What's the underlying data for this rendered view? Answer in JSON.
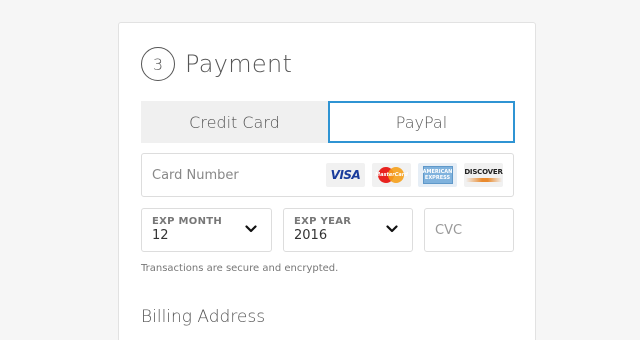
{
  "section": {
    "step_number": "3",
    "title": "Payment"
  },
  "tabs": [
    {
      "label": "Credit Card",
      "selected": false
    },
    {
      "label": "PayPal",
      "selected": true
    }
  ],
  "card_number": {
    "placeholder": "Card Number",
    "value": ""
  },
  "card_logos": {
    "visa": "VISA",
    "mastercard": "MasterCard",
    "amex": "AMERICAN EXPRESS",
    "discover": "DISCOVER"
  },
  "exp_month": {
    "label": "EXP MONTH",
    "value": "12"
  },
  "exp_year": {
    "label": "EXP YEAR",
    "value": "2016"
  },
  "cvc": {
    "placeholder": "CVC",
    "value": ""
  },
  "secure_note": "Transactions are secure and encrypted.",
  "billing_title": "Billing Address",
  "colors": {
    "accent_border": "#2f94d3",
    "tab_inactive_bg": "#f0f0f0"
  },
  "icons": [
    "chevron-down-icon",
    "visa-logo-icon",
    "mastercard-logo-icon",
    "amex-logo-icon",
    "discover-logo-icon"
  ]
}
